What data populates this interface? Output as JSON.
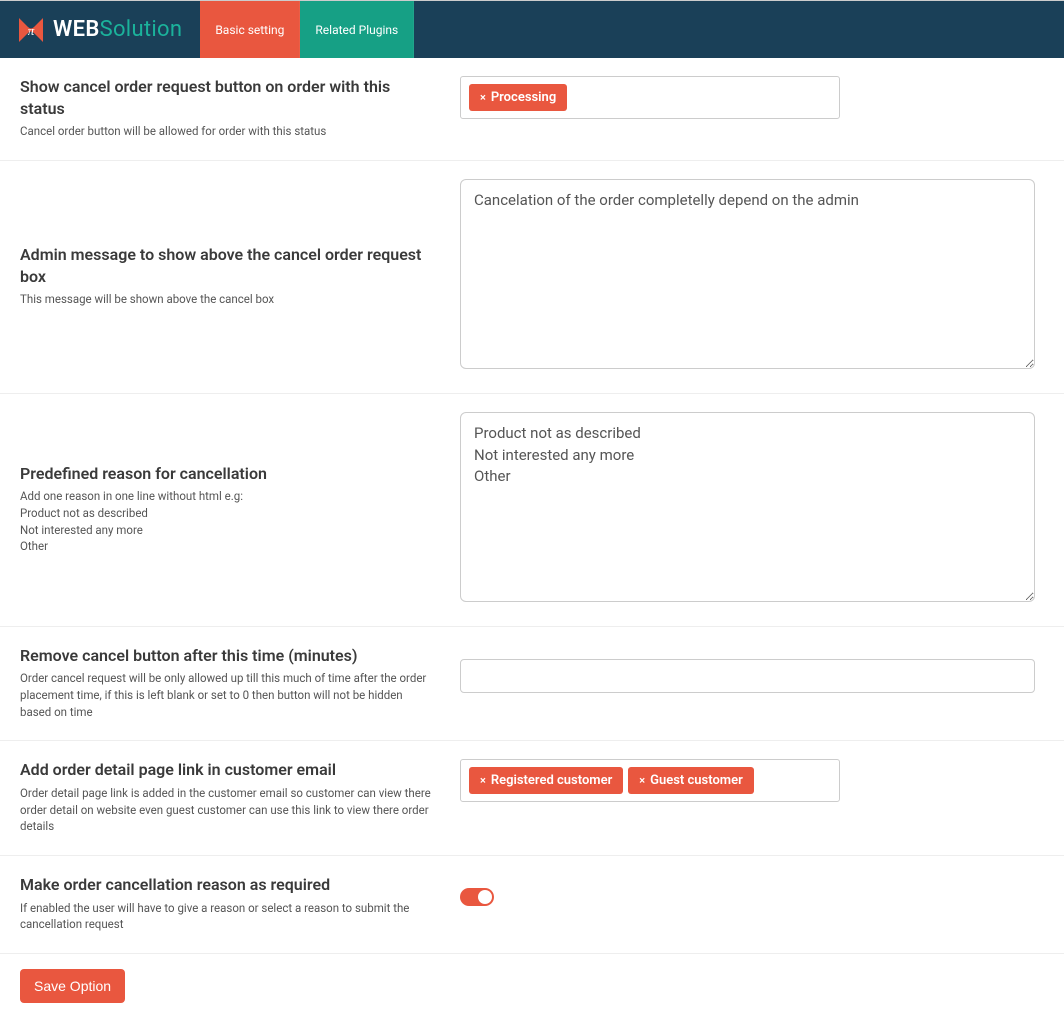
{
  "header": {
    "logo_web": "WEB",
    "logo_solution": "Solution",
    "tab_basic": "Basic setting",
    "tab_related": "Related Plugins"
  },
  "sections": {
    "status": {
      "title": "Show cancel order request button on order with this status",
      "desc": "Cancel order button will be allowed for order with this status",
      "tag": "Processing"
    },
    "admin_msg": {
      "title": "Admin message to show above the cancel order request box",
      "desc": "This message will be shown above the cancel box",
      "value": "Cancelation of the order completelly depend on the admin"
    },
    "reasons": {
      "title": "Predefined reason for cancellation",
      "desc_line1": "Add one reason in one line without html e.g:",
      "desc_line2": "Product not as described",
      "desc_line3": "Not interested any more",
      "desc_line4": "Other",
      "value": "Product not as described\nNot interested any more\nOther"
    },
    "remove_time": {
      "title": "Remove cancel button after this time (minutes)",
      "desc": "Order cancel request will be only allowed up till this much of time after the order placement time, if this is left blank or set to 0 then button will not be hidden based on time",
      "value": ""
    },
    "email_link": {
      "title": "Add order detail page link in customer email",
      "desc": "Order detail page link is added in the customer email so customer can view there order detail on website even guest customer can use this link to view there order details",
      "tag1": "Registered customer",
      "tag2": "Guest customer"
    },
    "required": {
      "title": "Make order cancellation reason as required",
      "desc": "If enabled the user will have to give a reason or select a reason to submit the cancellation request"
    }
  },
  "buttons": {
    "save": "Save Option"
  }
}
